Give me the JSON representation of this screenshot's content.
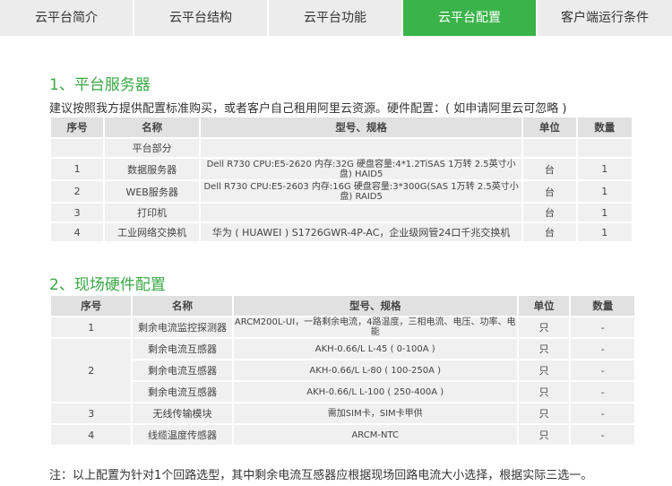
{
  "tabs": [
    {
      "label": "云平台简介"
    },
    {
      "label": "云平台结构"
    },
    {
      "label": "云平台功能"
    },
    {
      "label": "云平台配置",
      "active": true
    },
    {
      "label": "客户端运行条件"
    }
  ],
  "section1": {
    "title": "1、平台服务器",
    "desc": "建议按照我方提供配置标准购买，或者客户自己租用阿里云资源。硬件配置：( 如申请阿里云可忽略 )",
    "headers": [
      "序号",
      "名称",
      "型号、规格",
      "单位",
      "数量"
    ],
    "rows": [
      {
        "no": "",
        "name": "平台部分",
        "spec": "",
        "unit": "",
        "qty": ""
      },
      {
        "no": "1",
        "name": "数据服务器",
        "spec": "Dell R730 CPU:E5-2620 内存:32G  硬盘容量:4*1.2TiSAS 1万转 2.5英寸小盘) HAID5",
        "unit": "台",
        "qty": "1"
      },
      {
        "no": "2",
        "name": "WEB服务器",
        "spec": "Dell R730 CPU:E5-2603 内存:16G 硬盘容量:3*300G(SAS 1万转 2.5英寸小盘) RAID5",
        "unit": "台",
        "qty": "1"
      },
      {
        "no": "3",
        "name": "打印机",
        "spec": "",
        "unit": "台",
        "qty": "1"
      },
      {
        "no": "4",
        "name": "工业网络交换机",
        "spec": "华为 ( HUAWEI ) S1726GWR-4P-AC，企业级网管24口千兆交换机",
        "unit": "台",
        "qty": "1"
      }
    ]
  },
  "section2": {
    "title": "2、现场硬件配置",
    "headers": [
      "序号",
      "名称",
      "型号、规格",
      "单位",
      "数量"
    ],
    "rows": [
      {
        "no": "1",
        "name": "剩余电流监控探测器",
        "spec": "ARCM200L-UI，一路剩余电流，4路温度，三相电流、电压、功率、电能",
        "unit": "只",
        "qty": "-"
      },
      {
        "no": "2",
        "name": "剩余电流互感器",
        "spec": "AKH-0.66/L L-45 ( 0-100A )",
        "unit": "只",
        "qty": "-"
      },
      {
        "no": "",
        "name": "剩余电流互感器",
        "spec": "AKH-0.66/L L-80 ( 100-250A )",
        "unit": "只",
        "qty": "-"
      },
      {
        "no": "",
        "name": "剩余电流互感器",
        "spec": "AKH-0.66/L L-100 ( 250-400A )",
        "unit": "只",
        "qty": "-"
      },
      {
        "no": "3",
        "name": "无线传输模块",
        "spec": "需加SIM卡，SIM卡甲供",
        "unit": "只",
        "qty": "-"
      },
      {
        "no": "4",
        "name": "线缆温度传感器",
        "spec": "ARCM-NTC",
        "unit": "只",
        "qty": "-"
      }
    ]
  },
  "footnote": "注：以上配置为针对1个回路选型，其中剩余电流互感器应根据现场回路电流大小选择，根据实际三选一。"
}
